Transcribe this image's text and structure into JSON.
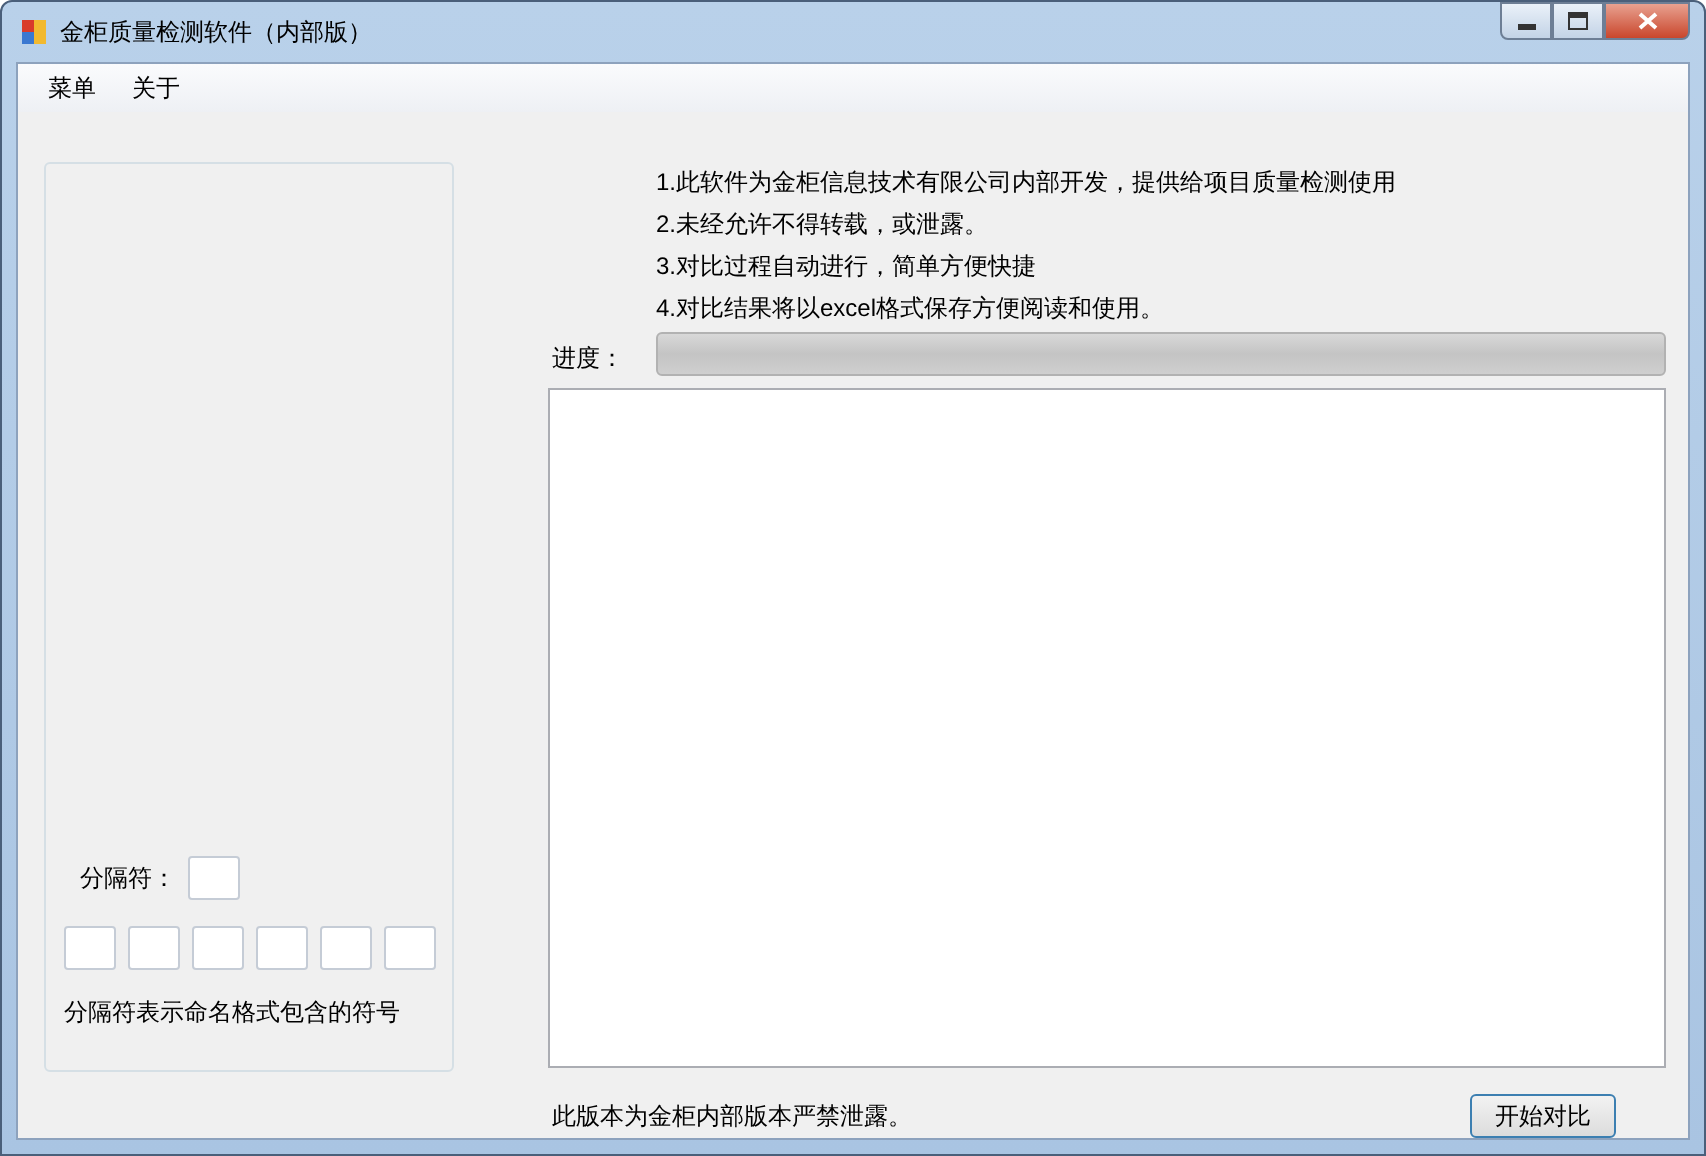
{
  "window": {
    "title": "金柜质量检测软件（内部版）"
  },
  "menu": [
    "菜单",
    "关于"
  ],
  "separator_panel": {
    "label": "分隔符：",
    "fields": [
      {
        "kind": "input"
      },
      {
        "kind": "input"
      },
      {
        "kind": "input"
      },
      {
        "kind": "input"
      },
      {
        "kind": "input"
      },
      {
        "kind": "input"
      }
    ],
    "hint": "分隔符表示命名格式包含的符号"
  },
  "notes": [
    "1.此软件为金柜信息技术有限公司内部开发，提供给项目质量检测使用",
    "2.未经允许不得转载，或泄露。",
    "3.对比过程自动进行，简单方便快捷",
    "4.对比结果将以excel格式保存方便阅读和使用。"
  ],
  "progress": {
    "label": "进度：",
    "level": 0
  },
  "footer": {
    "notice": "此版本为金柜内部版本严禁泄露。",
    "button": "开始对比"
  }
}
